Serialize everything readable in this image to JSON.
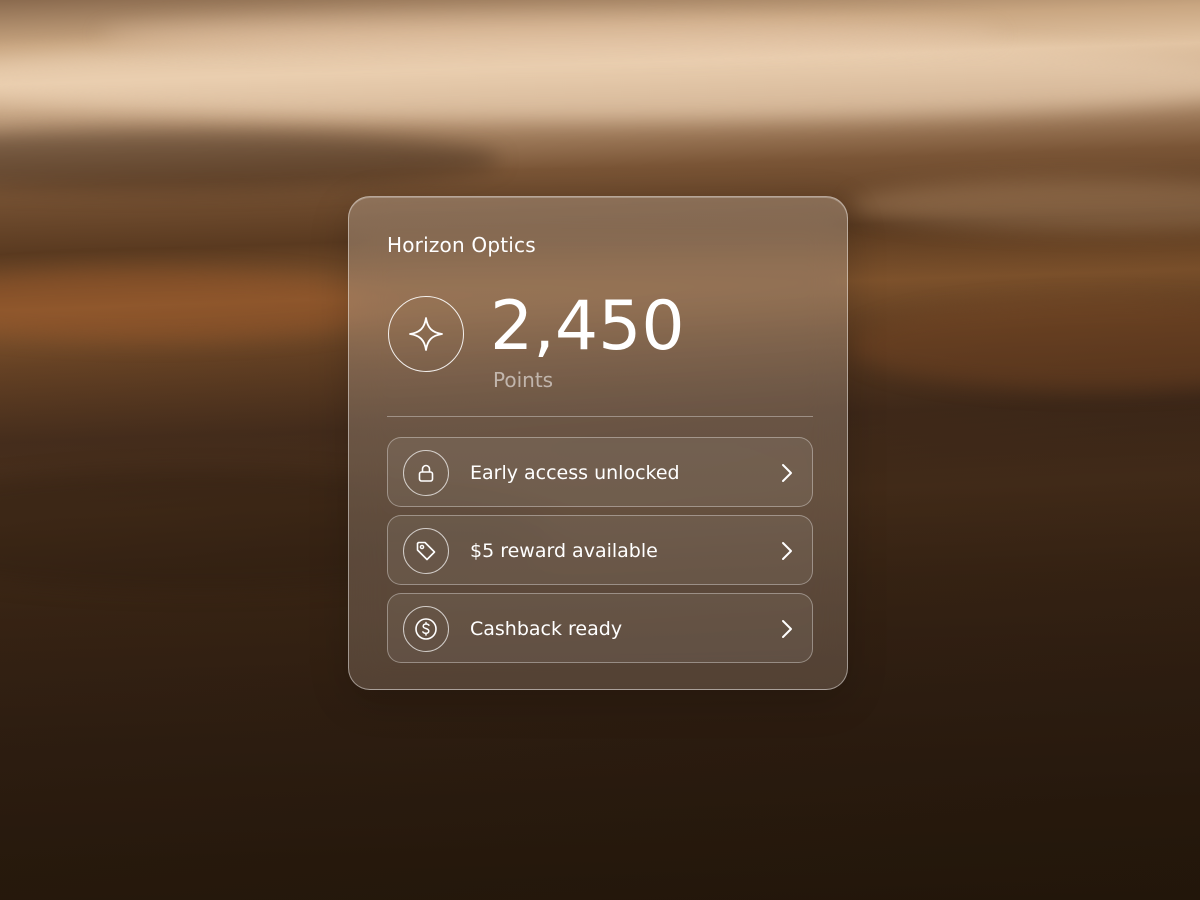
{
  "card": {
    "brand": "Horizon Optics",
    "points_value": "2,450",
    "points_label": "Points"
  },
  "icons": {
    "points": "sparkle-icon",
    "rows": [
      "lock-icon",
      "tag-icon",
      "dollar-icon"
    ],
    "chevron": "chevron-right-icon"
  },
  "rows": [
    {
      "label": "Early access unlocked"
    },
    {
      "label": "$5 reward available"
    },
    {
      "label": "Cashback ready"
    }
  ],
  "colors": {
    "text": "#ffffff",
    "muted_text": "rgba(255,255,255,0.55)",
    "card_border": "rgba(255,255,255,0.45)"
  }
}
